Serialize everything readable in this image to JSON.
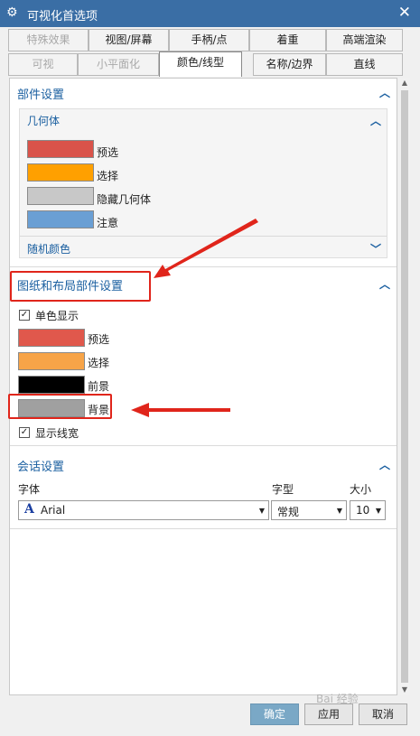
{
  "window": {
    "title": "可视化首选项",
    "close_symbol": "✕"
  },
  "tabs_row1": [
    "特殊效果",
    "视图/屏幕",
    "手柄/点",
    "着重",
    "高端渲染"
  ],
  "tabs_row2": [
    "可视",
    "小平面化",
    "颜色/线型",
    "名称/边界",
    "直线"
  ],
  "sections": {
    "part_settings": {
      "title": "部件设置",
      "geometry": {
        "title": "几何体",
        "items": [
          {
            "label": "预选",
            "color": "#d9534a"
          },
          {
            "label": "选择",
            "color": "#ffa000"
          },
          {
            "label": "隐藏几何体",
            "color": "#c8c8c8"
          },
          {
            "label": "注意",
            "color": "#6a9fd4"
          }
        ]
      },
      "random_color": "随机颜色"
    },
    "drawing_layout": {
      "title": "图纸和布局部件设置",
      "mono_display": "单色显示",
      "items": [
        {
          "label": "预选",
          "color": "#e0584c"
        },
        {
          "label": "选择",
          "color": "#f7a448"
        },
        {
          "label": "前景",
          "color": "#000000"
        },
        {
          "label": "背景",
          "color": "#a0a0a0"
        }
      ],
      "show_line_width": "显示线宽"
    },
    "session": {
      "title": "会话设置",
      "font_label": "字体",
      "font_value": "Arial",
      "font_icon": "A",
      "style_label": "字型",
      "style_value": "常规",
      "size_label": "大小",
      "size_value": "10"
    }
  },
  "buttons": {
    "ok": "确定",
    "apply": "应用",
    "cancel": "取消"
  },
  "watermark": "Bai 经验"
}
